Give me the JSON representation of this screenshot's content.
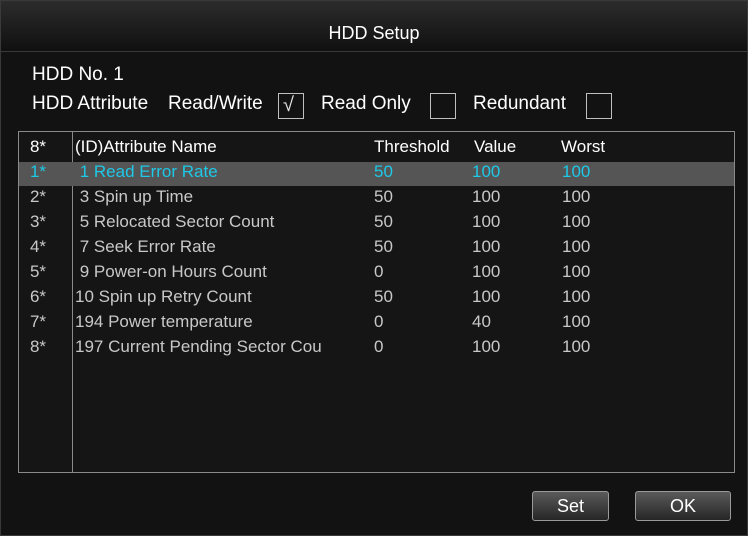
{
  "window": {
    "title": "HDD Setup"
  },
  "hdd": {
    "number_label": "HDD No. 1",
    "attribute_label": "HDD Attribute",
    "options": [
      {
        "label": "Read/Write",
        "checked": true
      },
      {
        "label": "Read Only",
        "checked": false
      },
      {
        "label": "Redundant",
        "checked": false
      }
    ],
    "check_glyph": "√"
  },
  "table": {
    "headers": {
      "index": "8*",
      "name": "(ID)Attribute Name",
      "threshold": "Threshold",
      "value": "Value",
      "worst": "Worst"
    },
    "rows": [
      {
        "index": "1*",
        "name": " 1 Read Error Rate",
        "threshold": "50",
        "value": "100",
        "worst": "100",
        "selected": true
      },
      {
        "index": "2*",
        "name": " 3 Spin up Time",
        "threshold": "50",
        "value": "100",
        "worst": "100"
      },
      {
        "index": "3*",
        "name": " 5 Relocated Sector Count",
        "threshold": "50",
        "value": "100",
        "worst": "100"
      },
      {
        "index": "4*",
        "name": " 7 Seek Error Rate",
        "threshold": "50",
        "value": "100",
        "worst": "100"
      },
      {
        "index": "5*",
        "name": " 9 Power-on Hours Count",
        "threshold": "0",
        "value": "100",
        "worst": "100"
      },
      {
        "index": "6*",
        "name": "10 Spin up Retry Count",
        "threshold": "50",
        "value": "100",
        "worst": "100"
      },
      {
        "index": "7*",
        "name": "194 Power temperature",
        "threshold": "0",
        "value": "40",
        "worst": "100"
      },
      {
        "index": "8*",
        "name": "197 Current Pending Sector Cou",
        "threshold": "0",
        "value": "100",
        "worst": "100"
      }
    ]
  },
  "buttons": {
    "set": "Set",
    "ok": "OK"
  },
  "colors": {
    "selected_text": "#1ec8e6",
    "selected_row_bg": "#555555",
    "normal_text": "#c8c8c8"
  }
}
